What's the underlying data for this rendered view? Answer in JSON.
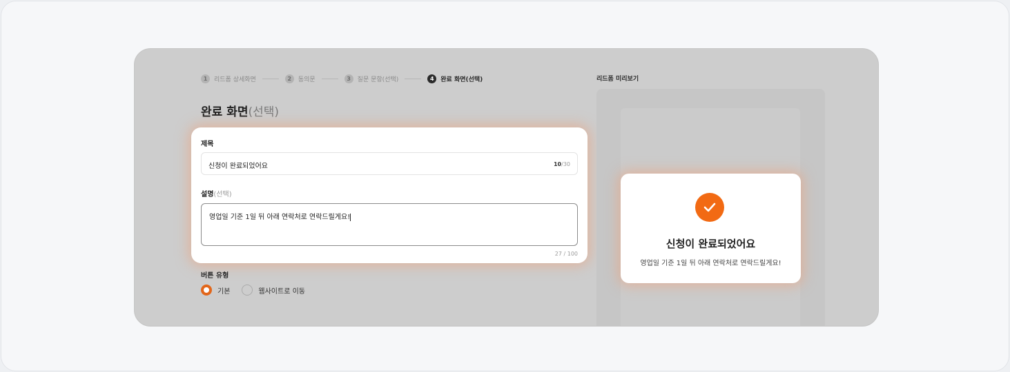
{
  "steps": [
    {
      "num": "1",
      "label": "리드폼 상세화면"
    },
    {
      "num": "2",
      "label": "동의문"
    },
    {
      "num": "3",
      "label": "질문 문항(선택)"
    },
    {
      "num": "4",
      "label": "완료 화면(선택)"
    }
  ],
  "page": {
    "title": "완료 화면",
    "title_optional": "(선택)"
  },
  "form": {
    "title_label": "제목",
    "title_value": "신청이 완료되었어요",
    "title_count_current": "10",
    "title_count_max": "/30",
    "desc_label": "설명",
    "desc_optional": "(선택)",
    "desc_value": "영업일 기준 1일 뒤 아래 연락처로 연락드릴게요!",
    "desc_count": "27 / 100"
  },
  "button_type": {
    "label": "버튼 유형",
    "options": [
      {
        "label": "기본",
        "selected": true
      },
      {
        "label": "웹사이트로 이동",
        "selected": false
      }
    ]
  },
  "preview": {
    "label": "리드폼 미리보기",
    "complete_title": "신청이 완료되었어요",
    "complete_desc": "영업일 기준 1일 뒤 아래 연락처로 연락드릴게요!",
    "icon": "check-icon"
  },
  "colors": {
    "accent": "#f26a13",
    "radio_selected": "#e2661a",
    "dim_overlay": "#cdcdcd"
  }
}
